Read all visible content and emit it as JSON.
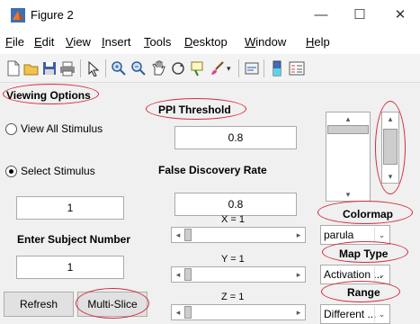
{
  "window": {
    "title": "Figure 2",
    "controls": {
      "minimize": "—",
      "maximize": "☐",
      "close": "✕"
    }
  },
  "menubar": {
    "items": [
      {
        "first": "F",
        "rest": "ile"
      },
      {
        "first": "E",
        "rest": "dit"
      },
      {
        "first": "V",
        "rest": "iew"
      },
      {
        "first": "I",
        "rest": "nsert"
      },
      {
        "first": "T",
        "rest": "ools"
      },
      {
        "first": "D",
        "rest": "esktop"
      },
      {
        "first": "W",
        "rest": "indow"
      },
      {
        "first": "H",
        "rest": "elp"
      }
    ]
  },
  "toolbar": {
    "icons": [
      "new-figure-icon",
      "open-file-icon",
      "save-icon",
      "print-icon",
      "pointer-icon",
      "zoom-in-icon",
      "zoom-out-icon",
      "pan-icon",
      "rotate-icon",
      "data-cursor-icon",
      "brush-icon",
      "link-plot-icon",
      "colorbar-icon",
      "legend-icon"
    ]
  },
  "viewing": {
    "header": "Viewing Options",
    "radio_all": "View All Stimulus",
    "radio_select": "Select Stimulus",
    "stimulus_value": "1",
    "subject_label": "Enter Subject Number",
    "subject_value": "1",
    "refresh": "Refresh",
    "multislice": "Multi-Slice"
  },
  "ppi": {
    "header": "PPI Threshold",
    "value": "0.8",
    "fdr_label": "False Discovery Rate",
    "fdr_value": "0.8"
  },
  "sliders": {
    "x_label": "X = 1",
    "y_label": "Y = 1",
    "z_label": "Z = 1"
  },
  "right": {
    "colormap_label": "Colormap",
    "colormap_value": "parula",
    "maptype_label": "Map Type",
    "maptype_value": "Activation ...",
    "range_label": "Range",
    "range_value": "Different ..."
  },
  "colors": {
    "annotation": "#d62a3a",
    "panel": "#f0f0f0"
  }
}
